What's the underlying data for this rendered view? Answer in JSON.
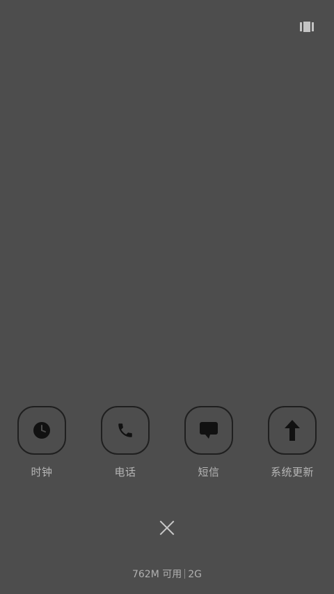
{
  "apps": [
    {
      "name": "clock",
      "label": "时钟",
      "icon": "clock-icon"
    },
    {
      "name": "phone",
      "label": "电话",
      "icon": "phone-icon"
    },
    {
      "name": "messages",
      "label": "短信",
      "icon": "message-icon"
    },
    {
      "name": "system-update",
      "label": "系统更新",
      "icon": "arrow-up-icon"
    }
  ],
  "memory": {
    "available": "762M 可用",
    "total": "2G"
  },
  "colors": {
    "background": "#4d4d4d",
    "icon_dark": "#111111",
    "text": "#b4b4b4"
  }
}
